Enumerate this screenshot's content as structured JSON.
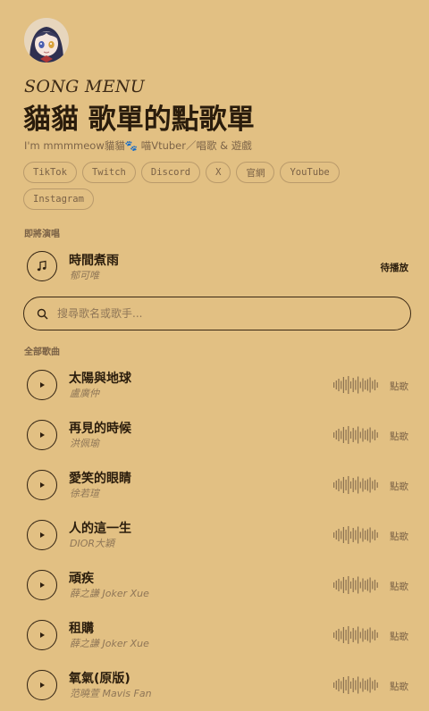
{
  "profile": {
    "avatar_icon": "avatar-girl-icon"
  },
  "header": {
    "eyebrow": "SONG MENU",
    "title": "貓貓 歌單的點歌單",
    "tagline": "I'm mmmmeow貓貓🐾 喵Vtuber／唱歌 & 遊戲"
  },
  "links": [
    "TikTok",
    "Twitch",
    "Discord",
    "X",
    "官網",
    "YouTube",
    "Instagram"
  ],
  "upcoming": {
    "label": "即將演唱",
    "song": {
      "title": "時間煮雨",
      "artist": "郁可唯",
      "status": "待播放",
      "icon": "music-note-icon"
    }
  },
  "search": {
    "placeholder": "搜尋歌名或歌手..."
  },
  "all_songs": {
    "label": "全部歌曲",
    "request_label": "點歌",
    "items": [
      {
        "title": "太陽與地球",
        "artist": "盧廣仲"
      },
      {
        "title": "再見的時候",
        "artist": "洪佩瑜"
      },
      {
        "title": "愛笑的眼睛",
        "artist": "徐若瑄"
      },
      {
        "title": "人的這一生",
        "artist": "DIOR大穎"
      },
      {
        "title": "頑疾",
        "artist": "薛之謙 Joker Xue"
      },
      {
        "title": "租購",
        "artist": "薛之謙 Joker Xue"
      },
      {
        "title": "氧氣(原版)",
        "artist": "范曉萱 Mavis Fan"
      }
    ]
  },
  "colors": {
    "background": "#e2c083",
    "ink": "#2a1c0c",
    "muted": "#8f7657",
    "border": "#b99a6b"
  }
}
